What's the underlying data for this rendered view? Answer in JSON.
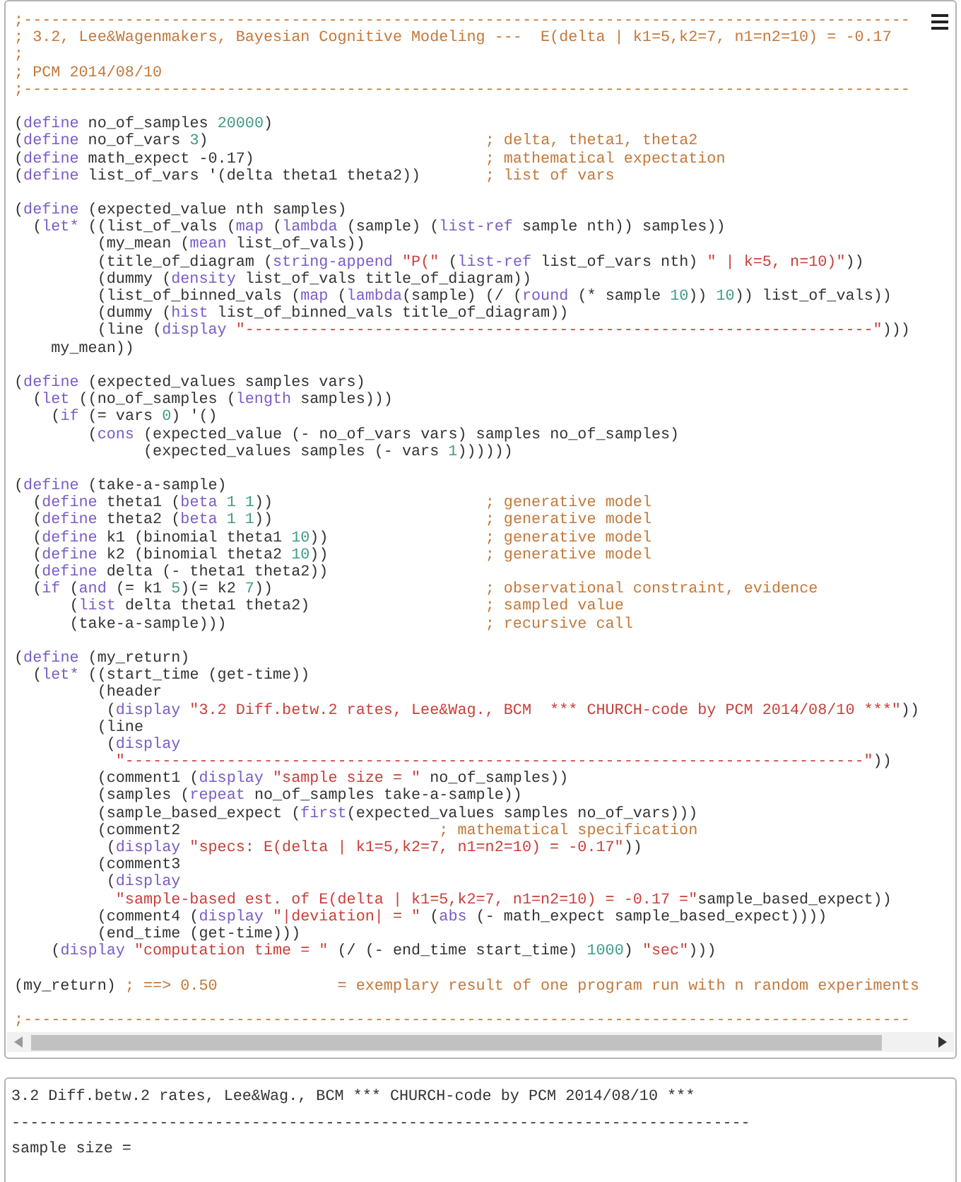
{
  "editor": {
    "blocks": [
      [
        [
          {
            "kind": "comment",
            "text": ";------------------------------------------------------------------------------------------------"
          }
        ],
        [
          {
            "kind": "comment",
            "text": "; 3.2, Lee&Wagenmakers, Bayesian Cognitive Modeling ---  E(delta | k1=5,k2=7, n1=n2=10) = -0.17"
          }
        ],
        [
          {
            "kind": "comment",
            "text": ";"
          }
        ],
        [
          {
            "kind": "comment",
            "text": "; PCM 2014/08/10"
          }
        ],
        [
          {
            "kind": "comment",
            "text": ";------------------------------------------------------------------------------------------------"
          }
        ]
      ],
      [
        [
          {
            "kind": "plain",
            "text": "("
          },
          {
            "kind": "keyword",
            "text": "define"
          },
          {
            "kind": "plain",
            "text": " no_of_samples "
          },
          {
            "kind": "number",
            "text": "20000"
          },
          {
            "kind": "plain",
            "text": ")"
          }
        ],
        [
          {
            "kind": "plain",
            "text": "("
          },
          {
            "kind": "keyword",
            "text": "define"
          },
          {
            "kind": "plain",
            "text": " no_of_vars "
          },
          {
            "kind": "number",
            "text": "3"
          },
          {
            "kind": "plain",
            "text": ")                              "
          },
          {
            "kind": "comment",
            "text": "; delta, theta1, theta2"
          }
        ],
        [
          {
            "kind": "plain",
            "text": "("
          },
          {
            "kind": "keyword",
            "text": "define"
          },
          {
            "kind": "plain",
            "text": " math_expect -0.17)                         "
          },
          {
            "kind": "comment",
            "text": "; mathematical expectation"
          }
        ],
        [
          {
            "kind": "plain",
            "text": "("
          },
          {
            "kind": "keyword",
            "text": "define"
          },
          {
            "kind": "plain",
            "text": " list_of_vars '(delta theta1 theta2))       "
          },
          {
            "kind": "comment",
            "text": "; list of vars"
          }
        ]
      ],
      [
        [
          {
            "kind": "plain",
            "text": "("
          },
          {
            "kind": "keyword",
            "text": "define"
          },
          {
            "kind": "plain",
            "text": " (expected_value nth samples)"
          }
        ],
        [
          {
            "kind": "plain",
            "text": "  ("
          },
          {
            "kind": "keyword",
            "text": "let*"
          },
          {
            "kind": "plain",
            "text": " ((list_of_vals ("
          },
          {
            "kind": "keyword",
            "text": "map"
          },
          {
            "kind": "plain",
            "text": " ("
          },
          {
            "kind": "keyword",
            "text": "lambda"
          },
          {
            "kind": "plain",
            "text": " (sample) ("
          },
          {
            "kind": "keyword",
            "text": "list-ref"
          },
          {
            "kind": "plain",
            "text": " sample nth)) samples))"
          }
        ],
        [
          {
            "kind": "plain",
            "text": "         (my_mean ("
          },
          {
            "kind": "keyword",
            "text": "mean"
          },
          {
            "kind": "plain",
            "text": " list_of_vals))"
          }
        ],
        [
          {
            "kind": "plain",
            "text": "         (title_of_diagram ("
          },
          {
            "kind": "keyword",
            "text": "string-append"
          },
          {
            "kind": "string",
            "text": " \"P(\""
          },
          {
            "kind": "plain",
            "text": " ("
          },
          {
            "kind": "keyword",
            "text": "list-ref"
          },
          {
            "kind": "plain",
            "text": " list_of_vars nth) "
          },
          {
            "kind": "string",
            "text": "\" | k=5, n=10)\""
          },
          {
            "kind": "plain",
            "text": "))"
          }
        ],
        [
          {
            "kind": "plain",
            "text": "         (dummy ("
          },
          {
            "kind": "keyword",
            "text": "density"
          },
          {
            "kind": "plain",
            "text": " list_of_vals title_of_diagram))"
          }
        ],
        [
          {
            "kind": "plain",
            "text": "         (list_of_binned_vals ("
          },
          {
            "kind": "keyword",
            "text": "map"
          },
          {
            "kind": "plain",
            "text": " ("
          },
          {
            "kind": "keyword",
            "text": "lambda"
          },
          {
            "kind": "plain",
            "text": "(sample) (/ ("
          },
          {
            "kind": "keyword",
            "text": "round"
          },
          {
            "kind": "plain",
            "text": " (* sample "
          },
          {
            "kind": "number",
            "text": "10"
          },
          {
            "kind": "plain",
            "text": ")) "
          },
          {
            "kind": "number",
            "text": "10"
          },
          {
            "kind": "plain",
            "text": ")) list_of_vals))"
          }
        ],
        [
          {
            "kind": "plain",
            "text": "         (dummy ("
          },
          {
            "kind": "keyword",
            "text": "hist"
          },
          {
            "kind": "plain",
            "text": " list_of_binned_vals title_of_diagram))"
          }
        ],
        [
          {
            "kind": "plain",
            "text": "         (line ("
          },
          {
            "kind": "keyword",
            "text": "display"
          },
          {
            "kind": "string",
            "text": " \"--------------------------------------------------------------------\""
          },
          {
            "kind": "plain",
            "text": ")))"
          }
        ],
        [
          {
            "kind": "plain",
            "text": "    my_mean))"
          }
        ]
      ],
      [
        [
          {
            "kind": "plain",
            "text": "("
          },
          {
            "kind": "keyword",
            "text": "define"
          },
          {
            "kind": "plain",
            "text": " (expected_values samples vars)"
          }
        ],
        [
          {
            "kind": "plain",
            "text": "  ("
          },
          {
            "kind": "keyword",
            "text": "let"
          },
          {
            "kind": "plain",
            "text": " ((no_of_samples ("
          },
          {
            "kind": "keyword",
            "text": "length"
          },
          {
            "kind": "plain",
            "text": " samples)))"
          }
        ],
        [
          {
            "kind": "plain",
            "text": "    ("
          },
          {
            "kind": "keyword",
            "text": "if"
          },
          {
            "kind": "plain",
            "text": " (= vars "
          },
          {
            "kind": "number",
            "text": "0"
          },
          {
            "kind": "plain",
            "text": ") '()"
          }
        ],
        [
          {
            "kind": "plain",
            "text": "        ("
          },
          {
            "kind": "keyword",
            "text": "cons"
          },
          {
            "kind": "plain",
            "text": " (expected_value (- no_of_vars vars) samples no_of_samples)"
          }
        ],
        [
          {
            "kind": "plain",
            "text": "              (expected_values samples (- vars "
          },
          {
            "kind": "number",
            "text": "1"
          },
          {
            "kind": "plain",
            "text": "))))))"
          }
        ]
      ],
      [
        [
          {
            "kind": "plain",
            "text": "("
          },
          {
            "kind": "keyword",
            "text": "define"
          },
          {
            "kind": "plain",
            "text": " (take-a-sample)"
          }
        ],
        [
          {
            "kind": "plain",
            "text": "  ("
          },
          {
            "kind": "keyword",
            "text": "define"
          },
          {
            "kind": "plain",
            "text": " theta1 ("
          },
          {
            "kind": "keyword",
            "text": "beta"
          },
          {
            "kind": "number",
            "text": " 1"
          },
          {
            "kind": "number",
            "text": " 1"
          },
          {
            "kind": "plain",
            "text": "))                       "
          },
          {
            "kind": "comment",
            "text": "; generative model"
          }
        ],
        [
          {
            "kind": "plain",
            "text": "  ("
          },
          {
            "kind": "keyword",
            "text": "define"
          },
          {
            "kind": "plain",
            "text": " theta2 ("
          },
          {
            "kind": "keyword",
            "text": "beta"
          },
          {
            "kind": "number",
            "text": " 1"
          },
          {
            "kind": "number",
            "text": " 1"
          },
          {
            "kind": "plain",
            "text": "))                       "
          },
          {
            "kind": "comment",
            "text": "; generative model"
          }
        ],
        [
          {
            "kind": "plain",
            "text": "  ("
          },
          {
            "kind": "keyword",
            "text": "define"
          },
          {
            "kind": "plain",
            "text": " k1 (binomial theta1 "
          },
          {
            "kind": "number",
            "text": "10"
          },
          {
            "kind": "plain",
            "text": "))                 "
          },
          {
            "kind": "comment",
            "text": "; generative model"
          }
        ],
        [
          {
            "kind": "plain",
            "text": "  ("
          },
          {
            "kind": "keyword",
            "text": "define"
          },
          {
            "kind": "plain",
            "text": " k2 (binomial theta2 "
          },
          {
            "kind": "number",
            "text": "10"
          },
          {
            "kind": "plain",
            "text": "))                 "
          },
          {
            "kind": "comment",
            "text": "; generative model"
          }
        ],
        [
          {
            "kind": "plain",
            "text": "  ("
          },
          {
            "kind": "keyword",
            "text": "define"
          },
          {
            "kind": "plain",
            "text": " delta (- theta1 theta2))"
          }
        ],
        [
          {
            "kind": "plain",
            "text": "  ("
          },
          {
            "kind": "keyword",
            "text": "if"
          },
          {
            "kind": "plain",
            "text": " ("
          },
          {
            "kind": "keyword",
            "text": "and"
          },
          {
            "kind": "plain",
            "text": " (= k1 "
          },
          {
            "kind": "number",
            "text": "5"
          },
          {
            "kind": "plain",
            "text": ")(= k2 "
          },
          {
            "kind": "number",
            "text": "7"
          },
          {
            "kind": "plain",
            "text": "))                       "
          },
          {
            "kind": "comment",
            "text": "; observational constraint, evidence"
          }
        ],
        [
          {
            "kind": "plain",
            "text": "      ("
          },
          {
            "kind": "keyword",
            "text": "list"
          },
          {
            "kind": "plain",
            "text": " delta theta1 theta2)                   "
          },
          {
            "kind": "comment",
            "text": "; sampled value"
          }
        ],
        [
          {
            "kind": "plain",
            "text": "      (take-a-sample)))                            "
          },
          {
            "kind": "comment",
            "text": "; recursive call"
          }
        ]
      ],
      [
        [
          {
            "kind": "plain",
            "text": "("
          },
          {
            "kind": "keyword",
            "text": "define"
          },
          {
            "kind": "plain",
            "text": " (my_return)"
          }
        ],
        [
          {
            "kind": "plain",
            "text": "  ("
          },
          {
            "kind": "keyword",
            "text": "let*"
          },
          {
            "kind": "plain",
            "text": " ((start_time (get-time))"
          }
        ],
        [
          {
            "kind": "plain",
            "text": "         (header"
          }
        ],
        [
          {
            "kind": "plain",
            "text": "          ("
          },
          {
            "kind": "keyword",
            "text": "display"
          },
          {
            "kind": "string",
            "text": " \"3.2 Diff.betw.2 rates, Lee&Wag., BCM  *** CHURCH-code by PCM 2014/08/10 ***\""
          },
          {
            "kind": "plain",
            "text": "))"
          }
        ],
        [
          {
            "kind": "plain",
            "text": "         (line"
          }
        ],
        [
          {
            "kind": "plain",
            "text": "          ("
          },
          {
            "kind": "keyword",
            "text": "display"
          }
        ],
        [
          {
            "kind": "string",
            "text": "           \"--------------------------------------------------------------------------------\""
          },
          {
            "kind": "plain",
            "text": "))"
          }
        ],
        [
          {
            "kind": "plain",
            "text": "         (comment1 ("
          },
          {
            "kind": "keyword",
            "text": "display"
          },
          {
            "kind": "string",
            "text": " \"sample size = \""
          },
          {
            "kind": "plain",
            "text": " no_of_samples))"
          }
        ],
        [
          {
            "kind": "plain",
            "text": "         (samples ("
          },
          {
            "kind": "keyword",
            "text": "repeat"
          },
          {
            "kind": "plain",
            "text": " no_of_samples take-a-sample))"
          }
        ],
        [
          {
            "kind": "plain",
            "text": "         (sample_based_expect ("
          },
          {
            "kind": "keyword",
            "text": "first"
          },
          {
            "kind": "plain",
            "text": "(expected_values samples no_of_vars)))"
          }
        ],
        [
          {
            "kind": "plain",
            "text": "         (comment2                            "
          },
          {
            "kind": "comment",
            "text": "; mathematical specification"
          }
        ],
        [
          {
            "kind": "plain",
            "text": "          ("
          },
          {
            "kind": "keyword",
            "text": "display"
          },
          {
            "kind": "string",
            "text": " \"specs: E(delta | k1=5,k2=7, n1=n2=10) = -0.17\""
          },
          {
            "kind": "plain",
            "text": "))"
          }
        ],
        [
          {
            "kind": "plain",
            "text": "         (comment3"
          }
        ],
        [
          {
            "kind": "plain",
            "text": "          ("
          },
          {
            "kind": "keyword",
            "text": "display"
          }
        ],
        [
          {
            "kind": "string",
            "text": "           \"sample-based est. of E(delta | k1=5,k2=7, n1=n2=10) = -0.17 =\""
          },
          {
            "kind": "plain",
            "text": "sample_based_expect))"
          }
        ],
        [
          {
            "kind": "plain",
            "text": "         (comment4 ("
          },
          {
            "kind": "keyword",
            "text": "display"
          },
          {
            "kind": "string",
            "text": " \"|deviation| = \""
          },
          {
            "kind": "plain",
            "text": " ("
          },
          {
            "kind": "keyword",
            "text": "abs"
          },
          {
            "kind": "plain",
            "text": " (- math_expect sample_based_expect))))"
          }
        ],
        [
          {
            "kind": "plain",
            "text": "         (end_time (get-time)))"
          }
        ],
        [
          {
            "kind": "plain",
            "text": "    ("
          },
          {
            "kind": "keyword",
            "text": "display"
          },
          {
            "kind": "string",
            "text": " \"computation time = \""
          },
          {
            "kind": "plain",
            "text": " (/ (- end_time start_time) "
          },
          {
            "kind": "number",
            "text": "1000"
          },
          {
            "kind": "plain",
            "text": ") "
          },
          {
            "kind": "string",
            "text": "\"sec\""
          },
          {
            "kind": "plain",
            "text": ")))"
          }
        ]
      ],
      [
        [
          {
            "kind": "plain",
            "text": "(my_return) "
          },
          {
            "kind": "comment",
            "text": "; ==> 0.50             = exemplary result of one program run with n random experiments"
          }
        ]
      ],
      [
        [
          {
            "kind": "comment",
            "text": ";------------------------------------------------------------------------------------------------"
          }
        ]
      ]
    ]
  },
  "output": {
    "lines": [
      "3.2 Diff.betw.2 rates, Lee&Wag., BCM *** CHURCH-code by PCM 2014/08/10 ***",
      "--------------------------------------------------------------------------------",
      "sample size ="
    ]
  }
}
